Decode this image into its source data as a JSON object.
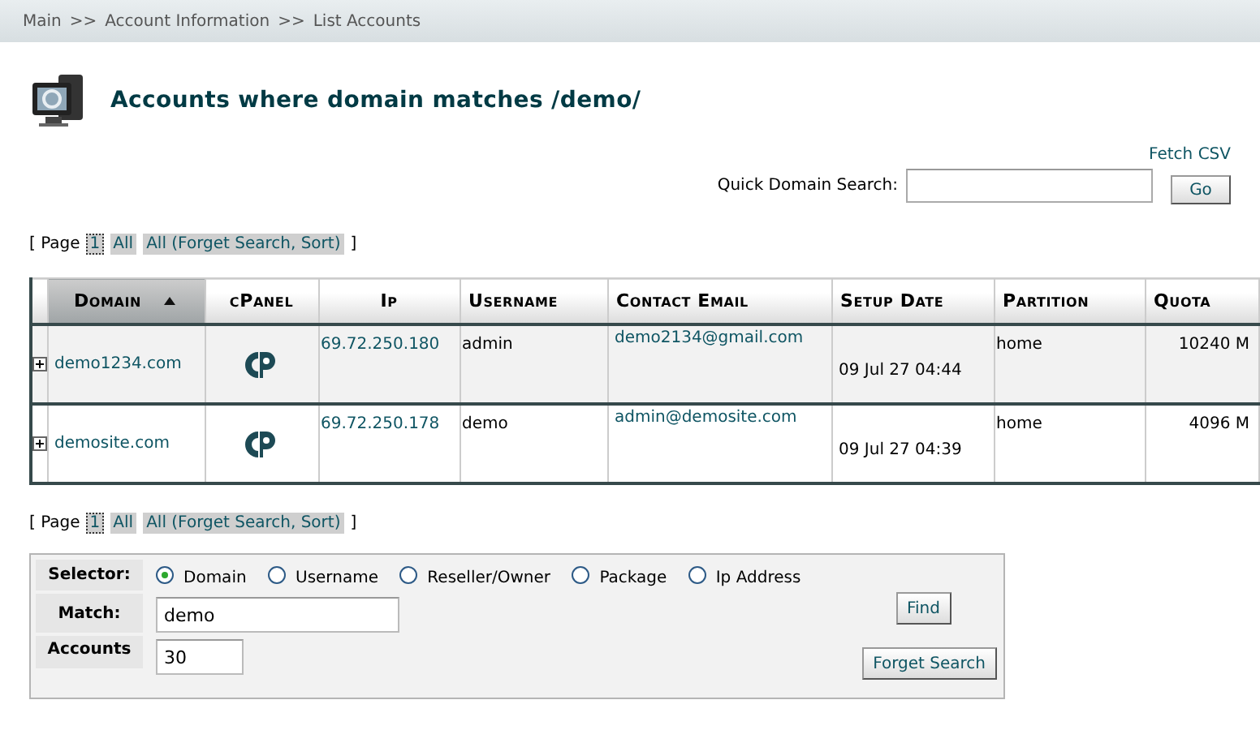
{
  "breadcrumb": [
    "Main",
    ">>",
    "Account Information",
    ">>",
    "List Accounts"
  ],
  "title": "Accounts where domain matches /demo/",
  "fetch_csv": "Fetch CSV",
  "quick_search": {
    "label": "Quick Domain Search:",
    "button": "Go"
  },
  "pager_top": {
    "prefix": "[ Page",
    "items": [
      {
        "label": "1",
        "selected": true
      },
      {
        "label": "All",
        "selected": false
      },
      {
        "label": "All (Forget Search, Sort)",
        "selected": false
      }
    ],
    "suffix": "]"
  },
  "table": {
    "columns": [
      {
        "label": "Domain",
        "sorted": true
      },
      {
        "label": "cPanel",
        "sorted": false
      },
      {
        "label": "Ip",
        "sorted": false
      },
      {
        "label": "Username",
        "sorted": false
      },
      {
        "label": "Contact Email",
        "sorted": false
      },
      {
        "label": "Setup Date",
        "sorted": false
      },
      {
        "label": "Partition",
        "sorted": false
      },
      {
        "label": "Quota",
        "sorted": false
      }
    ],
    "rows": [
      {
        "expanded": false,
        "domain": "demo1234.com",
        "ip": "69.72.250.180",
        "username": "admin",
        "email": "demo2134@gmail.com",
        "setup_date": "09 Jul 27 04:44",
        "partition": "home",
        "quota": "10240 M"
      },
      {
        "expanded": false,
        "domain": "demosite.com",
        "ip": "69.72.250.178",
        "username": "demo",
        "email": "admin@demosite.com",
        "setup_date": "09 Jul 27 04:39",
        "partition": "home",
        "quota": "4096 M"
      }
    ]
  },
  "pager_bottom": {
    "prefix": "[ Page",
    "items": [
      {
        "label": "1",
        "selected": true
      },
      {
        "label": "All",
        "selected": false
      },
      {
        "label": "All (Forget Search, Sort)",
        "selected": false
      }
    ],
    "suffix": "]"
  },
  "search_form": {
    "selector_label": "Selector:",
    "options": [
      {
        "label": "Domain",
        "selected": true
      },
      {
        "label": "Username",
        "selected": false
      },
      {
        "label": "Reseller/Owner",
        "selected": false
      },
      {
        "label": "Package",
        "selected": false
      },
      {
        "label": "Ip Address",
        "selected": false
      }
    ],
    "match_label": "Match:",
    "match_value": "demo",
    "per_page_label": "Accounts",
    "per_page_value": "30",
    "find_button": "Find",
    "forget_button": "Forget Search"
  }
}
